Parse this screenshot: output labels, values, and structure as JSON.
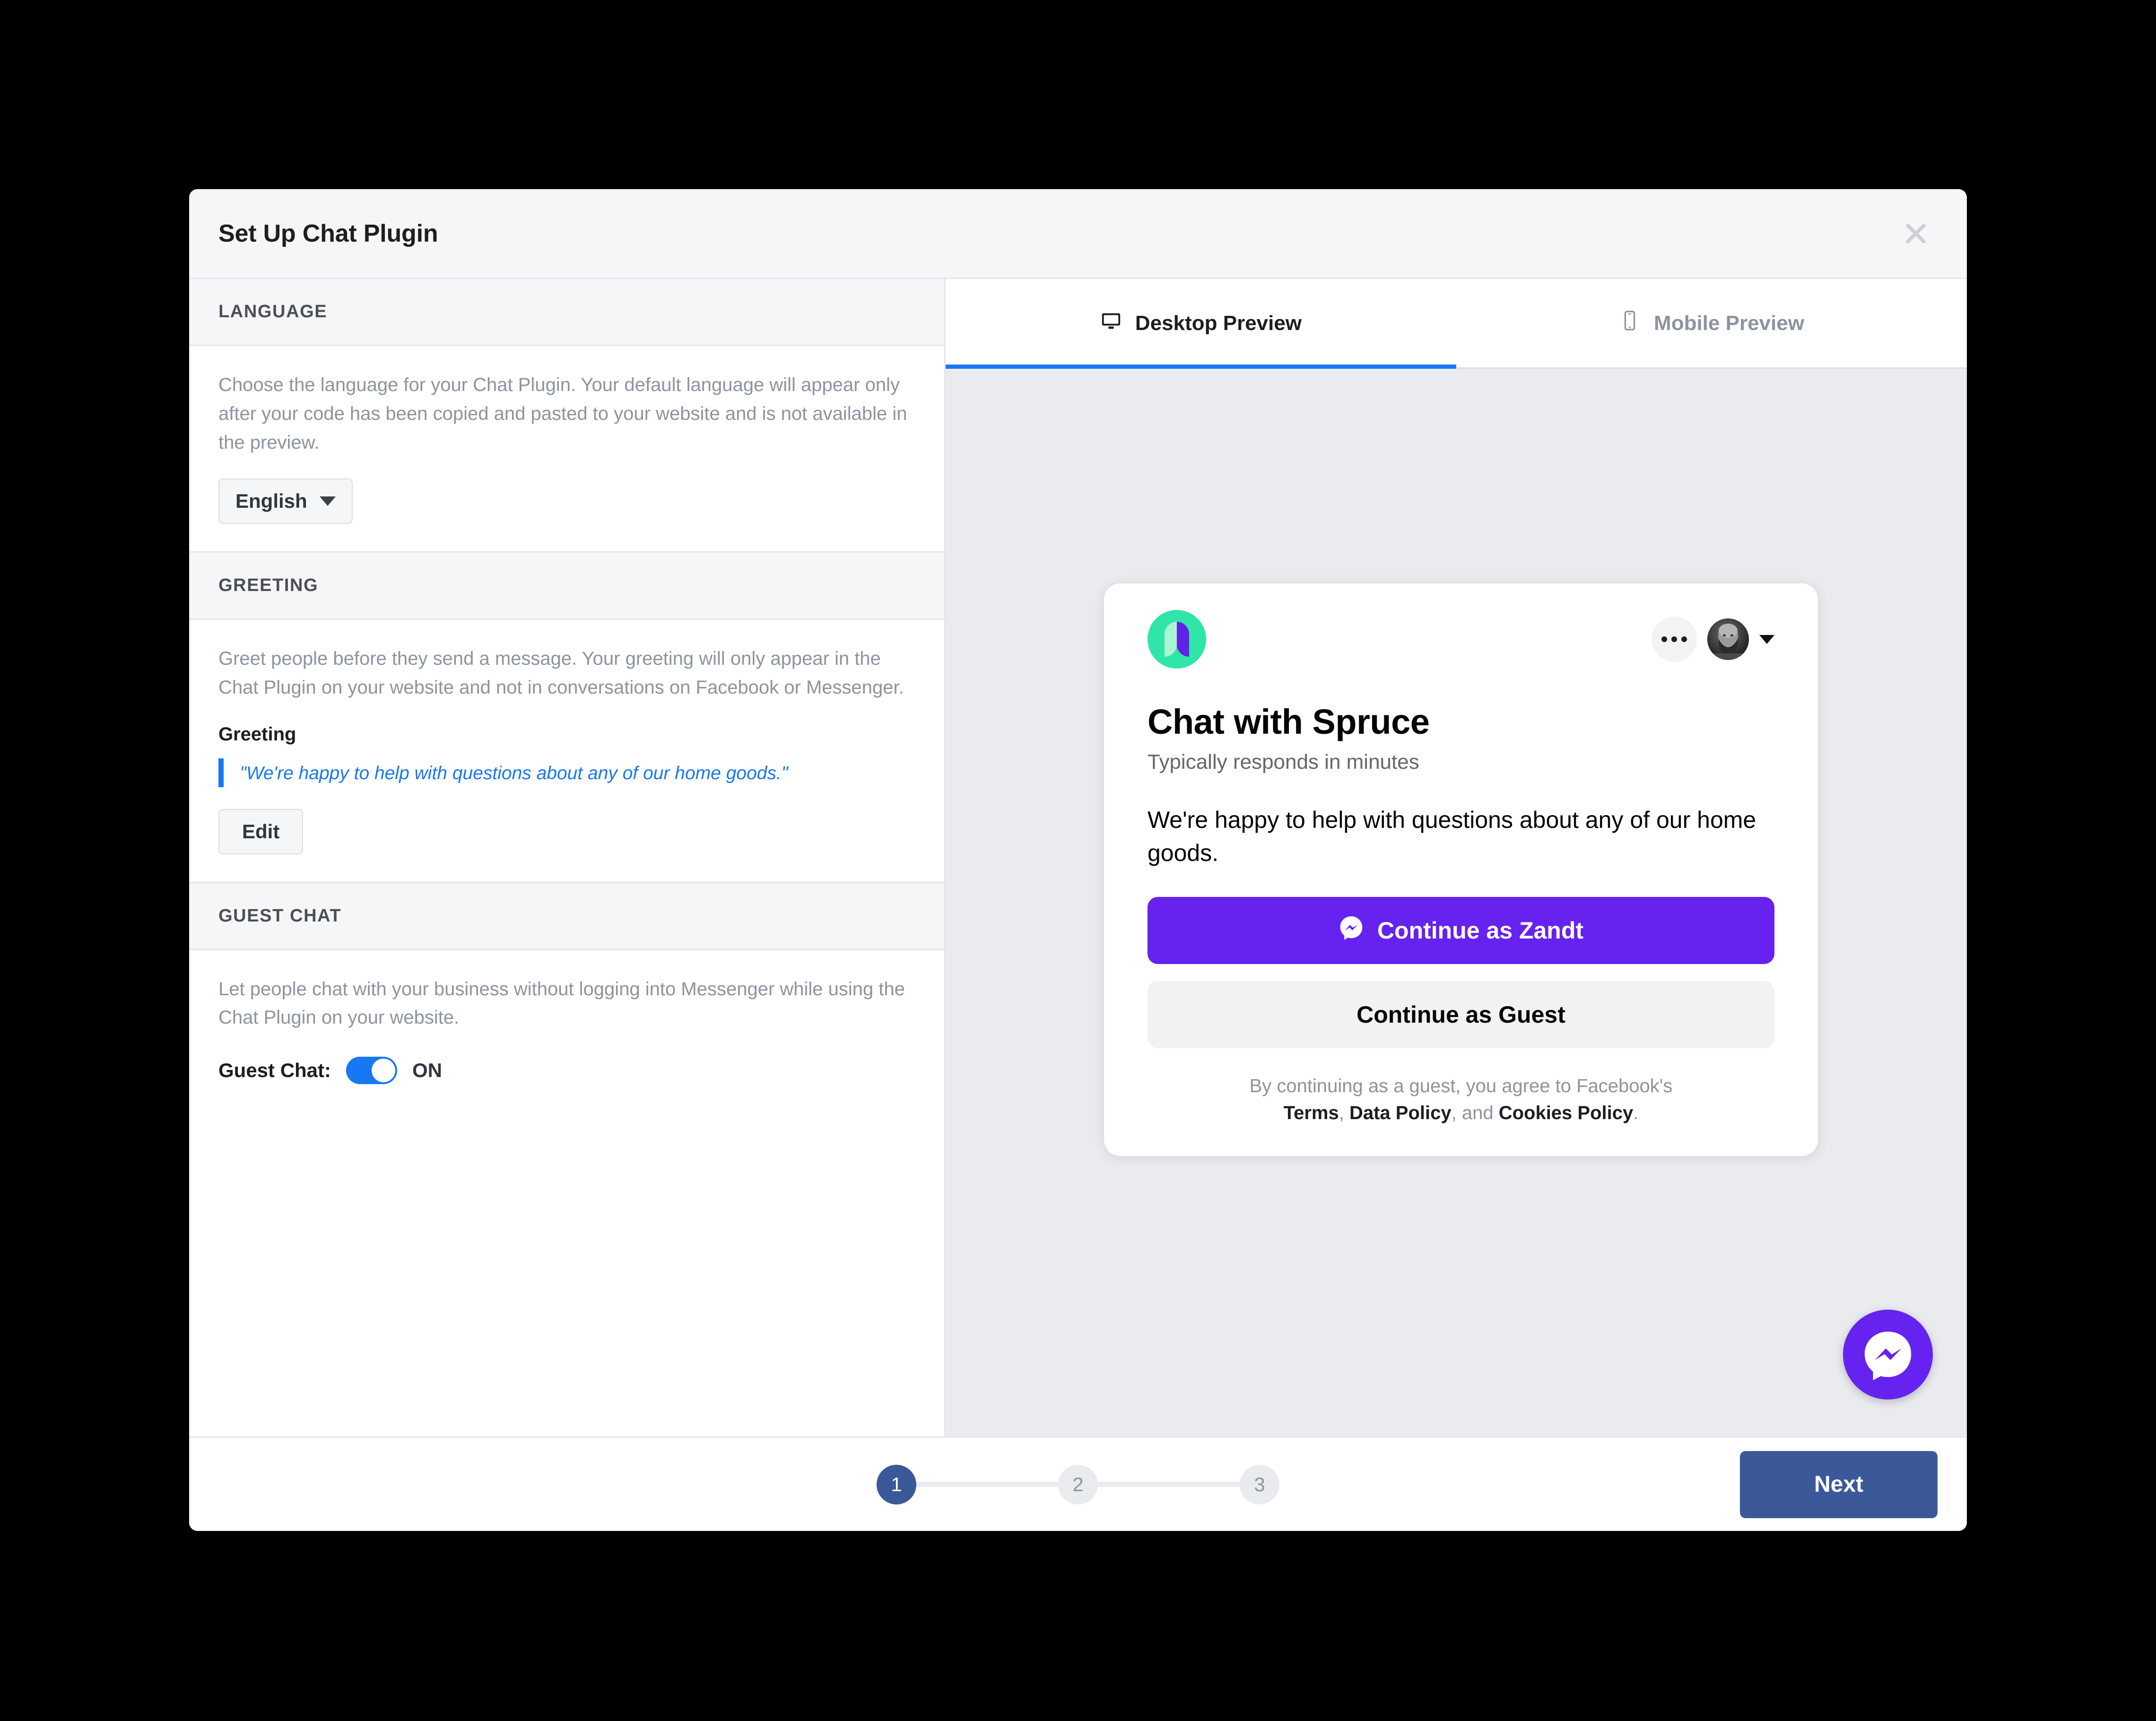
{
  "modal": {
    "title": "Set Up Chat Plugin",
    "close_icon": "close-icon"
  },
  "settings": {
    "language": {
      "header": "LANGUAGE",
      "description": "Choose the language for your Chat Plugin. Your default language will appear only after your code has been copied and pasted to your website and is not available in the preview.",
      "selected": "English"
    },
    "greeting": {
      "header": "GREETING",
      "description": "Greet people before they send a message. Your greeting will only appear in the Chat Plugin on your website and not in conversations on Facebook or Messenger.",
      "field_label": "Greeting",
      "value": "\"We're happy to help with questions about any of our home goods.\"",
      "edit_label": "Edit"
    },
    "guest_chat": {
      "header": "GUEST CHAT",
      "description": "Let people chat with your business without logging into Messenger while using the Chat Plugin on your website.",
      "toggle_label": "Guest Chat:",
      "toggle_state": "ON",
      "toggle_on": true
    }
  },
  "preview": {
    "tabs": [
      {
        "label": "Desktop Preview",
        "icon": "desktop-icon",
        "active": true
      },
      {
        "label": "Mobile Preview",
        "icon": "mobile-icon",
        "active": false
      }
    ],
    "card": {
      "brand_logo": "spruce-leaf-logo",
      "options_icon": "more-options-icon",
      "avatar": "user-avatar",
      "avatar_caret": "chevron-down-icon",
      "title": "Chat with Spruce",
      "subtitle": "Typically responds in minutes",
      "greeting": "We're happy to help with questions about any of our home goods.",
      "primary_cta": "Continue as Zandt",
      "primary_cta_icon": "messenger-icon",
      "secondary_cta": "Continue as Guest",
      "legal_prefix": "By continuing as a guest, you agree to Facebook's",
      "legal_terms": "Terms",
      "legal_comma1": ",",
      "legal_data_policy": "Data Policy",
      "legal_and": ", and ",
      "legal_cookies_policy": "Cookies Policy",
      "legal_period": "."
    },
    "bubble_icon": "messenger-bubble-icon"
  },
  "footer": {
    "steps": [
      "1",
      "2",
      "3"
    ],
    "active_step": 1,
    "next_label": "Next"
  },
  "colors": {
    "facebook_blue": "#1877f2",
    "button_blue": "#3b5998",
    "messenger_purple": "#6622ee",
    "brand_green": "#2fe6a8",
    "panel_gray": "#e9ebee"
  }
}
